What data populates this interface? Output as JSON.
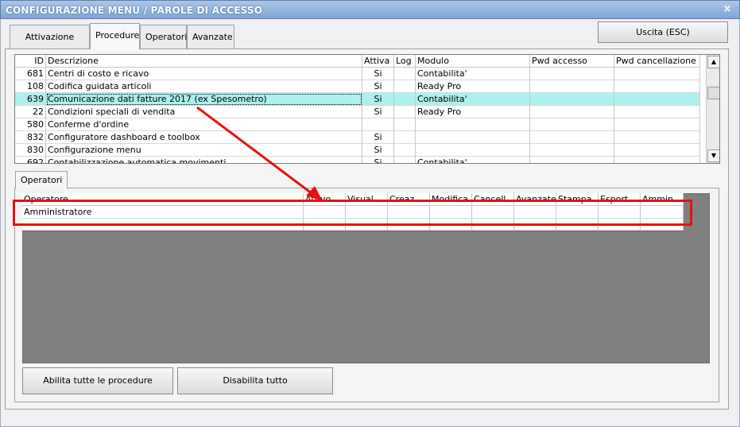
{
  "window": {
    "title": "CONFIGURAZIONE MENU / PAROLE DI ACCESSO",
    "close_glyph": "×"
  },
  "tabs": [
    {
      "label": "Attivazione moduli"
    },
    {
      "label": "Procedure",
      "active": true
    },
    {
      "label": "Operatori"
    },
    {
      "label": "Avanzate"
    }
  ],
  "exit_button": {
    "label": "Uscita (ESC)"
  },
  "procedures_table": {
    "columns": [
      "ID",
      "Descrizione",
      "Attiva",
      "Log",
      "Modulo",
      "Pwd accesso",
      "Pwd cancellazione"
    ],
    "rows": [
      {
        "id": "681",
        "descrizione": "Centri di costo e ricavo",
        "attiva": "Si",
        "log": "",
        "modulo": "Contabilita'",
        "pwd_accesso": "",
        "pwd_cancellazione": ""
      },
      {
        "id": "108",
        "descrizione": "Codifica guidata articoli",
        "attiva": "Si",
        "log": "",
        "modulo": "Ready Pro",
        "pwd_accesso": "",
        "pwd_cancellazione": ""
      },
      {
        "id": "639",
        "descrizione": "Comunicazione dati fatture 2017 (ex Spesometro)",
        "attiva": "Si",
        "log": "",
        "modulo": "Contabilita'",
        "pwd_accesso": "",
        "pwd_cancellazione": "",
        "selected": true
      },
      {
        "id": "22",
        "descrizione": "Condizioni speciali di vendita",
        "attiva": "Si",
        "log": "",
        "modulo": "Ready Pro",
        "pwd_accesso": "",
        "pwd_cancellazione": ""
      },
      {
        "id": "580",
        "descrizione": "Conferme d'ordine",
        "attiva": "",
        "log": "",
        "modulo": "",
        "pwd_accesso": "",
        "pwd_cancellazione": ""
      },
      {
        "id": "832",
        "descrizione": "Configuratore dashboard e toolbox",
        "attiva": "Si",
        "log": "",
        "modulo": "",
        "pwd_accesso": "",
        "pwd_cancellazione": ""
      },
      {
        "id": "830",
        "descrizione": "Configurazione menu",
        "attiva": "Si",
        "log": "",
        "modulo": "",
        "pwd_accesso": "",
        "pwd_cancellazione": ""
      },
      {
        "id": "692",
        "descrizione": "Contabilizzazione automatica movimenti",
        "attiva": "Si",
        "log": "",
        "modulo": "Contabilita'",
        "pwd_accesso": "",
        "pwd_cancellazione": ""
      }
    ]
  },
  "operators_section": {
    "tab_label": "Operatori",
    "columns": [
      "Operatore",
      "Attivo",
      "Visual.",
      "Creaz.",
      "Modifica",
      "Cancell.",
      "Avanzate",
      "Stampa",
      "Esport.",
      "Ammin."
    ],
    "rows": [
      {
        "operatore": "Amministratore"
      }
    ]
  },
  "buttons": {
    "enable_all": "Abilita tutte le procedure",
    "disable_all": "Disabilita tutto"
  },
  "scrollbar": {
    "up_glyph": "▲",
    "down_glyph": "▼"
  },
  "annotation": {
    "color": "#e81010"
  }
}
